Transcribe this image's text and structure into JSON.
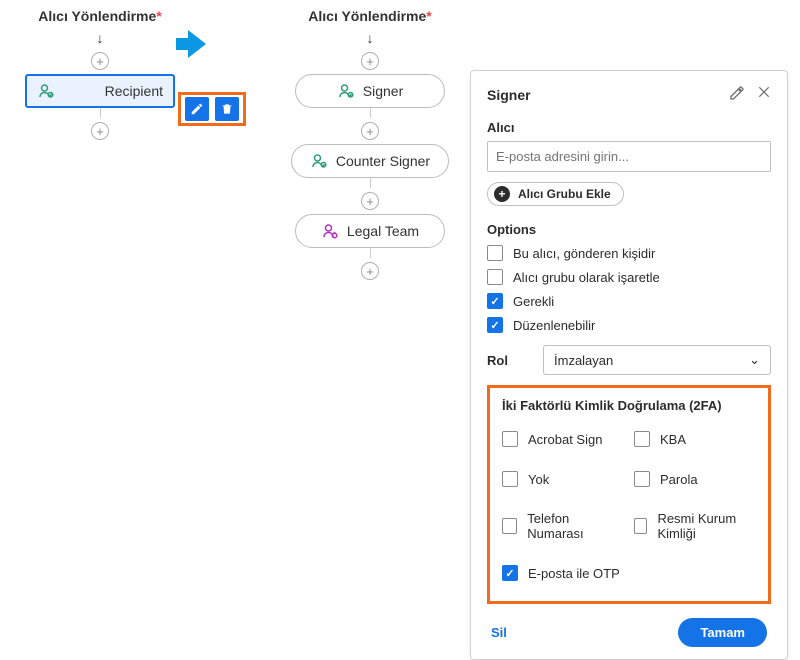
{
  "flow1": {
    "title": "Alıcı Yönlendirme",
    "nodes": [
      {
        "label": "Recipient",
        "iconColor": "#2d9d78",
        "selected": true
      }
    ]
  },
  "flow2": {
    "title": "Alıcı Yönlendirme",
    "nodes": [
      {
        "label": "Signer",
        "iconColor": "#2d9d78",
        "selected": false
      },
      {
        "label": "Counter Signer",
        "iconColor": "#2d9d78",
        "selected": false
      },
      {
        "label": "Legal Team",
        "iconColor": "#b130bd",
        "selected": false
      }
    ]
  },
  "panel": {
    "title": "Signer",
    "recipientLabel": "Alıcı",
    "emailPlaceholder": "E-posta adresini girin...",
    "addGroupLabel": "Alıcı Grubu Ekle",
    "optionsLabel": "Options",
    "options": [
      {
        "label": "Bu alıcı, gönderen kişidir",
        "checked": false
      },
      {
        "label": "Alıcı grubu olarak işaretle",
        "checked": false
      },
      {
        "label": "Gerekli",
        "checked": true
      },
      {
        "label": "Düzenlenebilir",
        "checked": true
      }
    ],
    "roleLabel": "Rol",
    "roleValue": "İmzalayan",
    "twofa": {
      "title": "İki Faktörlü Kimlik Doğrulama (2FA)",
      "items": [
        {
          "label": "Acrobat Sign",
          "checked": false
        },
        {
          "label": "KBA",
          "checked": false
        },
        {
          "label": "Yok",
          "checked": false
        },
        {
          "label": "Parola",
          "checked": false
        },
        {
          "label": "Telefon Numarası",
          "checked": false
        },
        {
          "label": "Resmi Kurum Kimliği",
          "checked": false
        },
        {
          "label": "E-posta ile OTP",
          "checked": true
        }
      ]
    },
    "deleteLabel": "Sil",
    "okLabel": "Tamam"
  }
}
